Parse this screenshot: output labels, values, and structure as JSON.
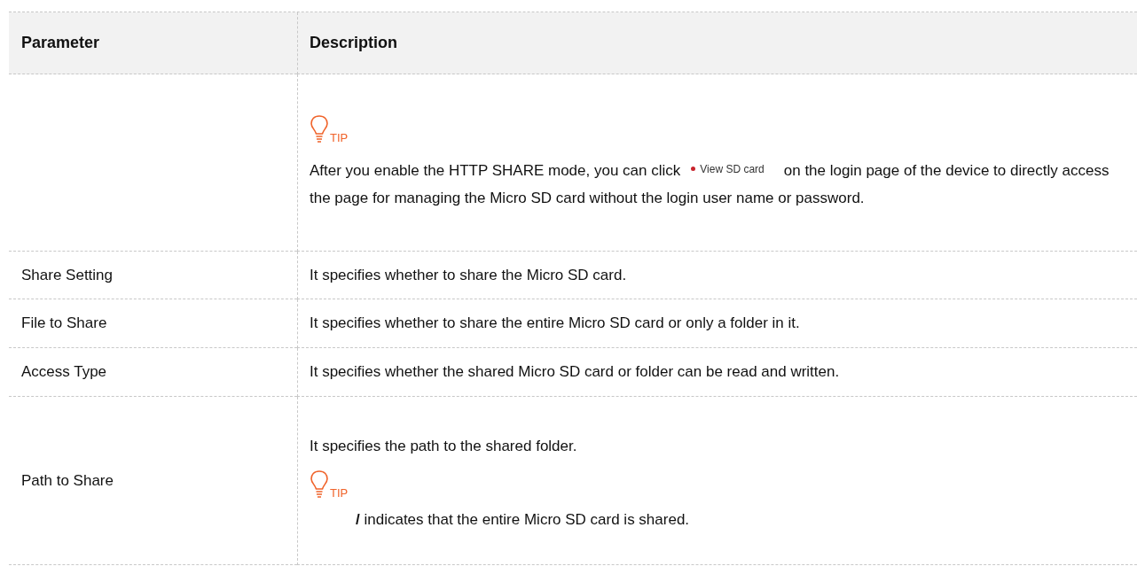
{
  "table": {
    "columns": [
      "Parameter",
      "Description"
    ],
    "rows": [
      {
        "description": [
          {
            "kind": "tip",
            "label": "TIP"
          },
          {
            "kind": "paragraph",
            "parts": [
              {
                "kind": "text",
                "text": "After you enable the HTTP SHARE mode, you can click"
              },
              {
                "kind": "link",
                "text": "View SD card"
              },
              {
                "kind": "text",
                "text": "on the login page of the device to directly access the page for managing the Micro SD card without the login user name or password."
              }
            ]
          }
        ]
      },
      {
        "parameter": "Share Setting",
        "description": [
          {
            "kind": "text",
            "text": "It specifies whether to share the Micro SD card."
          }
        ]
      },
      {
        "parameter": "File to Share",
        "description": [
          {
            "kind": "text",
            "text": "It specifies whether to share the entire Micro SD card or only a folder in it."
          }
        ]
      },
      {
        "parameter": "Access Type",
        "description": [
          {
            "kind": "text",
            "text": "It specifies whether the shared Micro SD card or folder can be read and written."
          }
        ]
      },
      {
        "parameter": "Path to Share",
        "description": [
          {
            "kind": "text",
            "text": "It specifies the path to the shared folder."
          },
          {
            "kind": "tip",
            "label": "TIP"
          },
          {
            "kind": "note",
            "text": "**/** indicates that the entire Micro SD card is shared."
          }
        ]
      }
    ]
  }
}
